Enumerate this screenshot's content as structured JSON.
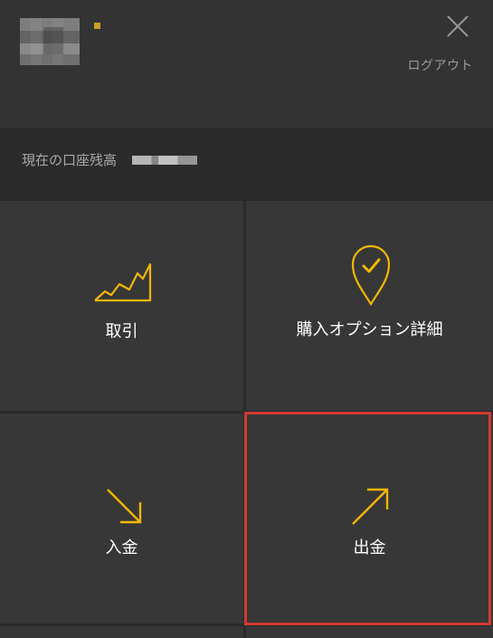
{
  "header": {
    "logout_label": "ログアウト",
    "avatar_icon": "user-avatar-icon",
    "close_icon": "close-icon"
  },
  "balance": {
    "label": "現在の口座残高"
  },
  "tiles": [
    {
      "label": "取引",
      "icon": "trade-chart-icon"
    },
    {
      "label": "購入オプション詳細",
      "icon": "location-check-icon"
    },
    {
      "label": "入金",
      "icon": "arrow-down-right-icon"
    },
    {
      "label": "出金",
      "icon": "arrow-up-right-icon"
    }
  ],
  "colors": {
    "accent": "#f2b705",
    "highlight_border": "#d23a32",
    "tile_bg": "#373737",
    "header_bg": "#333333"
  }
}
